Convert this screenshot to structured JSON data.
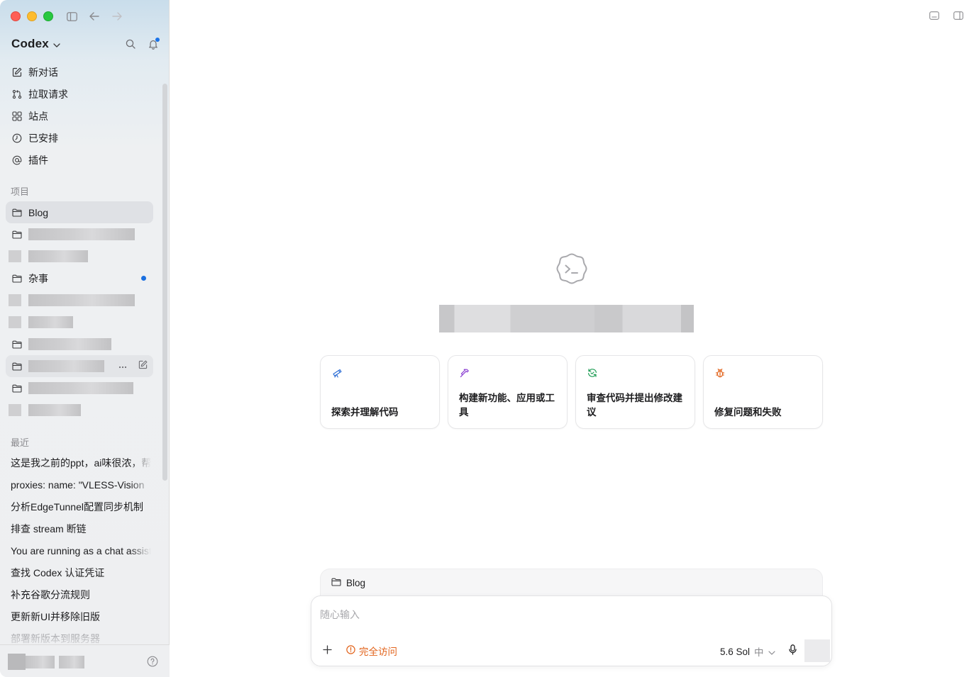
{
  "sidebar": {
    "brand": "Codex",
    "nav": [
      {
        "label": "新对话",
        "icon": "compose-icon"
      },
      {
        "label": "拉取请求",
        "icon": "pull-request-icon"
      },
      {
        "label": "站点",
        "icon": "sites-icon"
      },
      {
        "label": "已安排",
        "icon": "clock-icon"
      },
      {
        "label": "插件",
        "icon": "plugin-icon"
      }
    ],
    "projects_label": "项目",
    "projects": {
      "blog": "Blog",
      "misc": "杂事"
    },
    "recent_label": "最近",
    "recents": [
      "这是我之前的ppt，ai味很浓，帮",
      "proxies: name: \"VLESS-Vision",
      "分析EdgeTunnel配置同步机制",
      "排查 stream 断链",
      "You are running as a chat assistant",
      "查找 Codex 认证凭证",
      "补充谷歌分流规则",
      "更新新UI并移除旧版",
      "部署新版本到服务器"
    ]
  },
  "main": {
    "cards": [
      {
        "label": "探索并理解代码",
        "icon": "telescope-icon",
        "color": "#2f6fd6"
      },
      {
        "label": "构建新功能、应用或工具",
        "icon": "hammer-icon",
        "color": "#8a3fd1"
      },
      {
        "label": "审查代码并提出修改建议",
        "icon": "review-icon",
        "color": "#1f9d55"
      },
      {
        "label": "修复问题和失败",
        "icon": "bug-icon",
        "color": "#e2631b"
      }
    ],
    "composer": {
      "project": "Blog",
      "placeholder": "随心输入",
      "access": "完全访问",
      "model": "5.6 Sol",
      "level": "中"
    }
  },
  "colors": {
    "accent": "#1a73e8",
    "warning": "#e2631b"
  }
}
